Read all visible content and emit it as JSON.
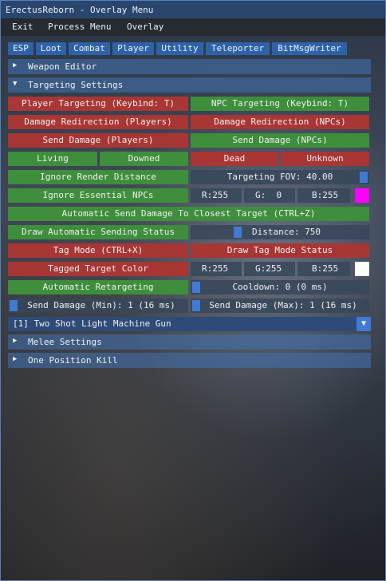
{
  "window": {
    "title": "ErectusReborn - Overlay Menu"
  },
  "menubar": [
    "Exit",
    "Process Menu",
    "Overlay"
  ],
  "tabs": [
    "ESP",
    "Loot",
    "Combat",
    "Player",
    "Utility",
    "Teleporter",
    "BitMsgWriter"
  ],
  "sections": {
    "weapon_editor": "Weapon Editor",
    "targeting_settings": "Targeting Settings",
    "melee_settings": "Melee Settings",
    "one_position_kill": "One Position Kill"
  },
  "targeting": {
    "player_targeting": "Player Targeting (Keybind: T)",
    "npc_targeting": "NPC Targeting (Keybind: T)",
    "damage_redirection_players": "Damage Redirection (Players)",
    "damage_redirection_npcs": "Damage Redirection (NPCs)",
    "send_damage_players": "Send Damage (Players)",
    "send_damage_npcs": "Send Damage (NPCs)",
    "living": "Living",
    "downed": "Downed",
    "dead": "Dead",
    "unknown": "Unknown",
    "ignore_render_distance": "Ignore Render Distance",
    "targeting_fov": "Targeting FOV: 40.00",
    "ignore_essential_npcs": "Ignore Essential NPCs",
    "color1": {
      "r": "R:255",
      "g": "G:  0",
      "b": "B:255",
      "swatch": "#ff00ff"
    },
    "auto_send_damage": "Automatic Send Damage To Closest Target (CTRL+Z)",
    "draw_auto_sending_status": "Draw Automatic Sending Status",
    "distance": "Distance: 750",
    "tag_mode": "Tag Mode (CTRL+X)",
    "draw_tag_mode_status": "Draw Tag Mode Status",
    "tagged_target_color": "Tagged Target Color",
    "color2": {
      "r": "R:255",
      "g": "G:255",
      "b": "B:255",
      "swatch": "#ffffff"
    },
    "automatic_retargeting": "Automatic Retargeting",
    "cooldown": "Cooldown: 0 (0 ms)",
    "send_damage_min": "Send Damage (Min): 1 (16 ms)",
    "send_damage_max": "Send Damage (Max): 1 (16 ms)",
    "weapon_select": "[1] Two Shot Light Machine Gun"
  },
  "icons": {
    "collapsed": "triangle-right-icon",
    "expanded": "triangle-down-icon",
    "combo": "triangle-down-icon"
  }
}
